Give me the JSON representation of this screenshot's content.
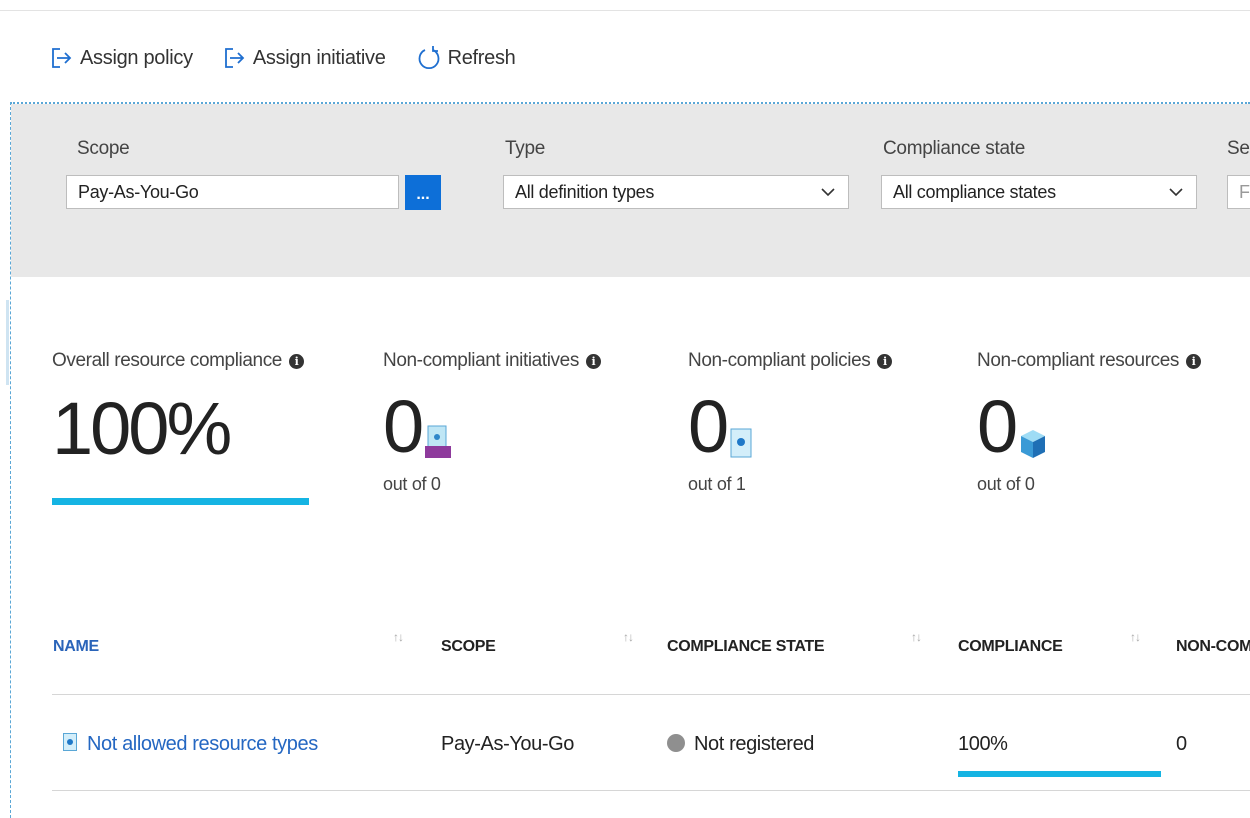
{
  "toolbar": {
    "assign_policy": "Assign policy",
    "assign_initiative": "Assign initiative",
    "refresh": "Refresh"
  },
  "filters": {
    "scope": {
      "label": "Scope",
      "value": "Pay-As-You-Go",
      "button": "..."
    },
    "type": {
      "label": "Type",
      "value": "All definition types"
    },
    "compliance_state": {
      "label": "Compliance state",
      "value": "All compliance states"
    },
    "search": {
      "label": "Se",
      "placeholder": "F"
    }
  },
  "stats": {
    "overall": {
      "label": "Overall resource compliance",
      "value": "100%",
      "percent": 100
    },
    "initiatives": {
      "label": "Non-compliant initiatives",
      "value": "0",
      "sub": "out of 0"
    },
    "policies": {
      "label": "Non-compliant policies",
      "value": "0",
      "sub": "out of 1"
    },
    "resources": {
      "label": "Non-compliant resources",
      "value": "0",
      "sub": "out of 0"
    }
  },
  "table": {
    "headers": [
      "NAME",
      "SCOPE",
      "COMPLIANCE STATE",
      "COMPLIANCE",
      "NON-COM"
    ],
    "rows": [
      {
        "name": "Not allowed resource types",
        "scope": "Pay-As-You-Go",
        "state": "Not registered",
        "compliance": "100%",
        "compliance_percent": 100,
        "noncompliant": "0"
      }
    ]
  },
  "colors": {
    "accent": "#15b4e3",
    "primary_button": "#0d6fd8",
    "link": "#2467c2"
  }
}
